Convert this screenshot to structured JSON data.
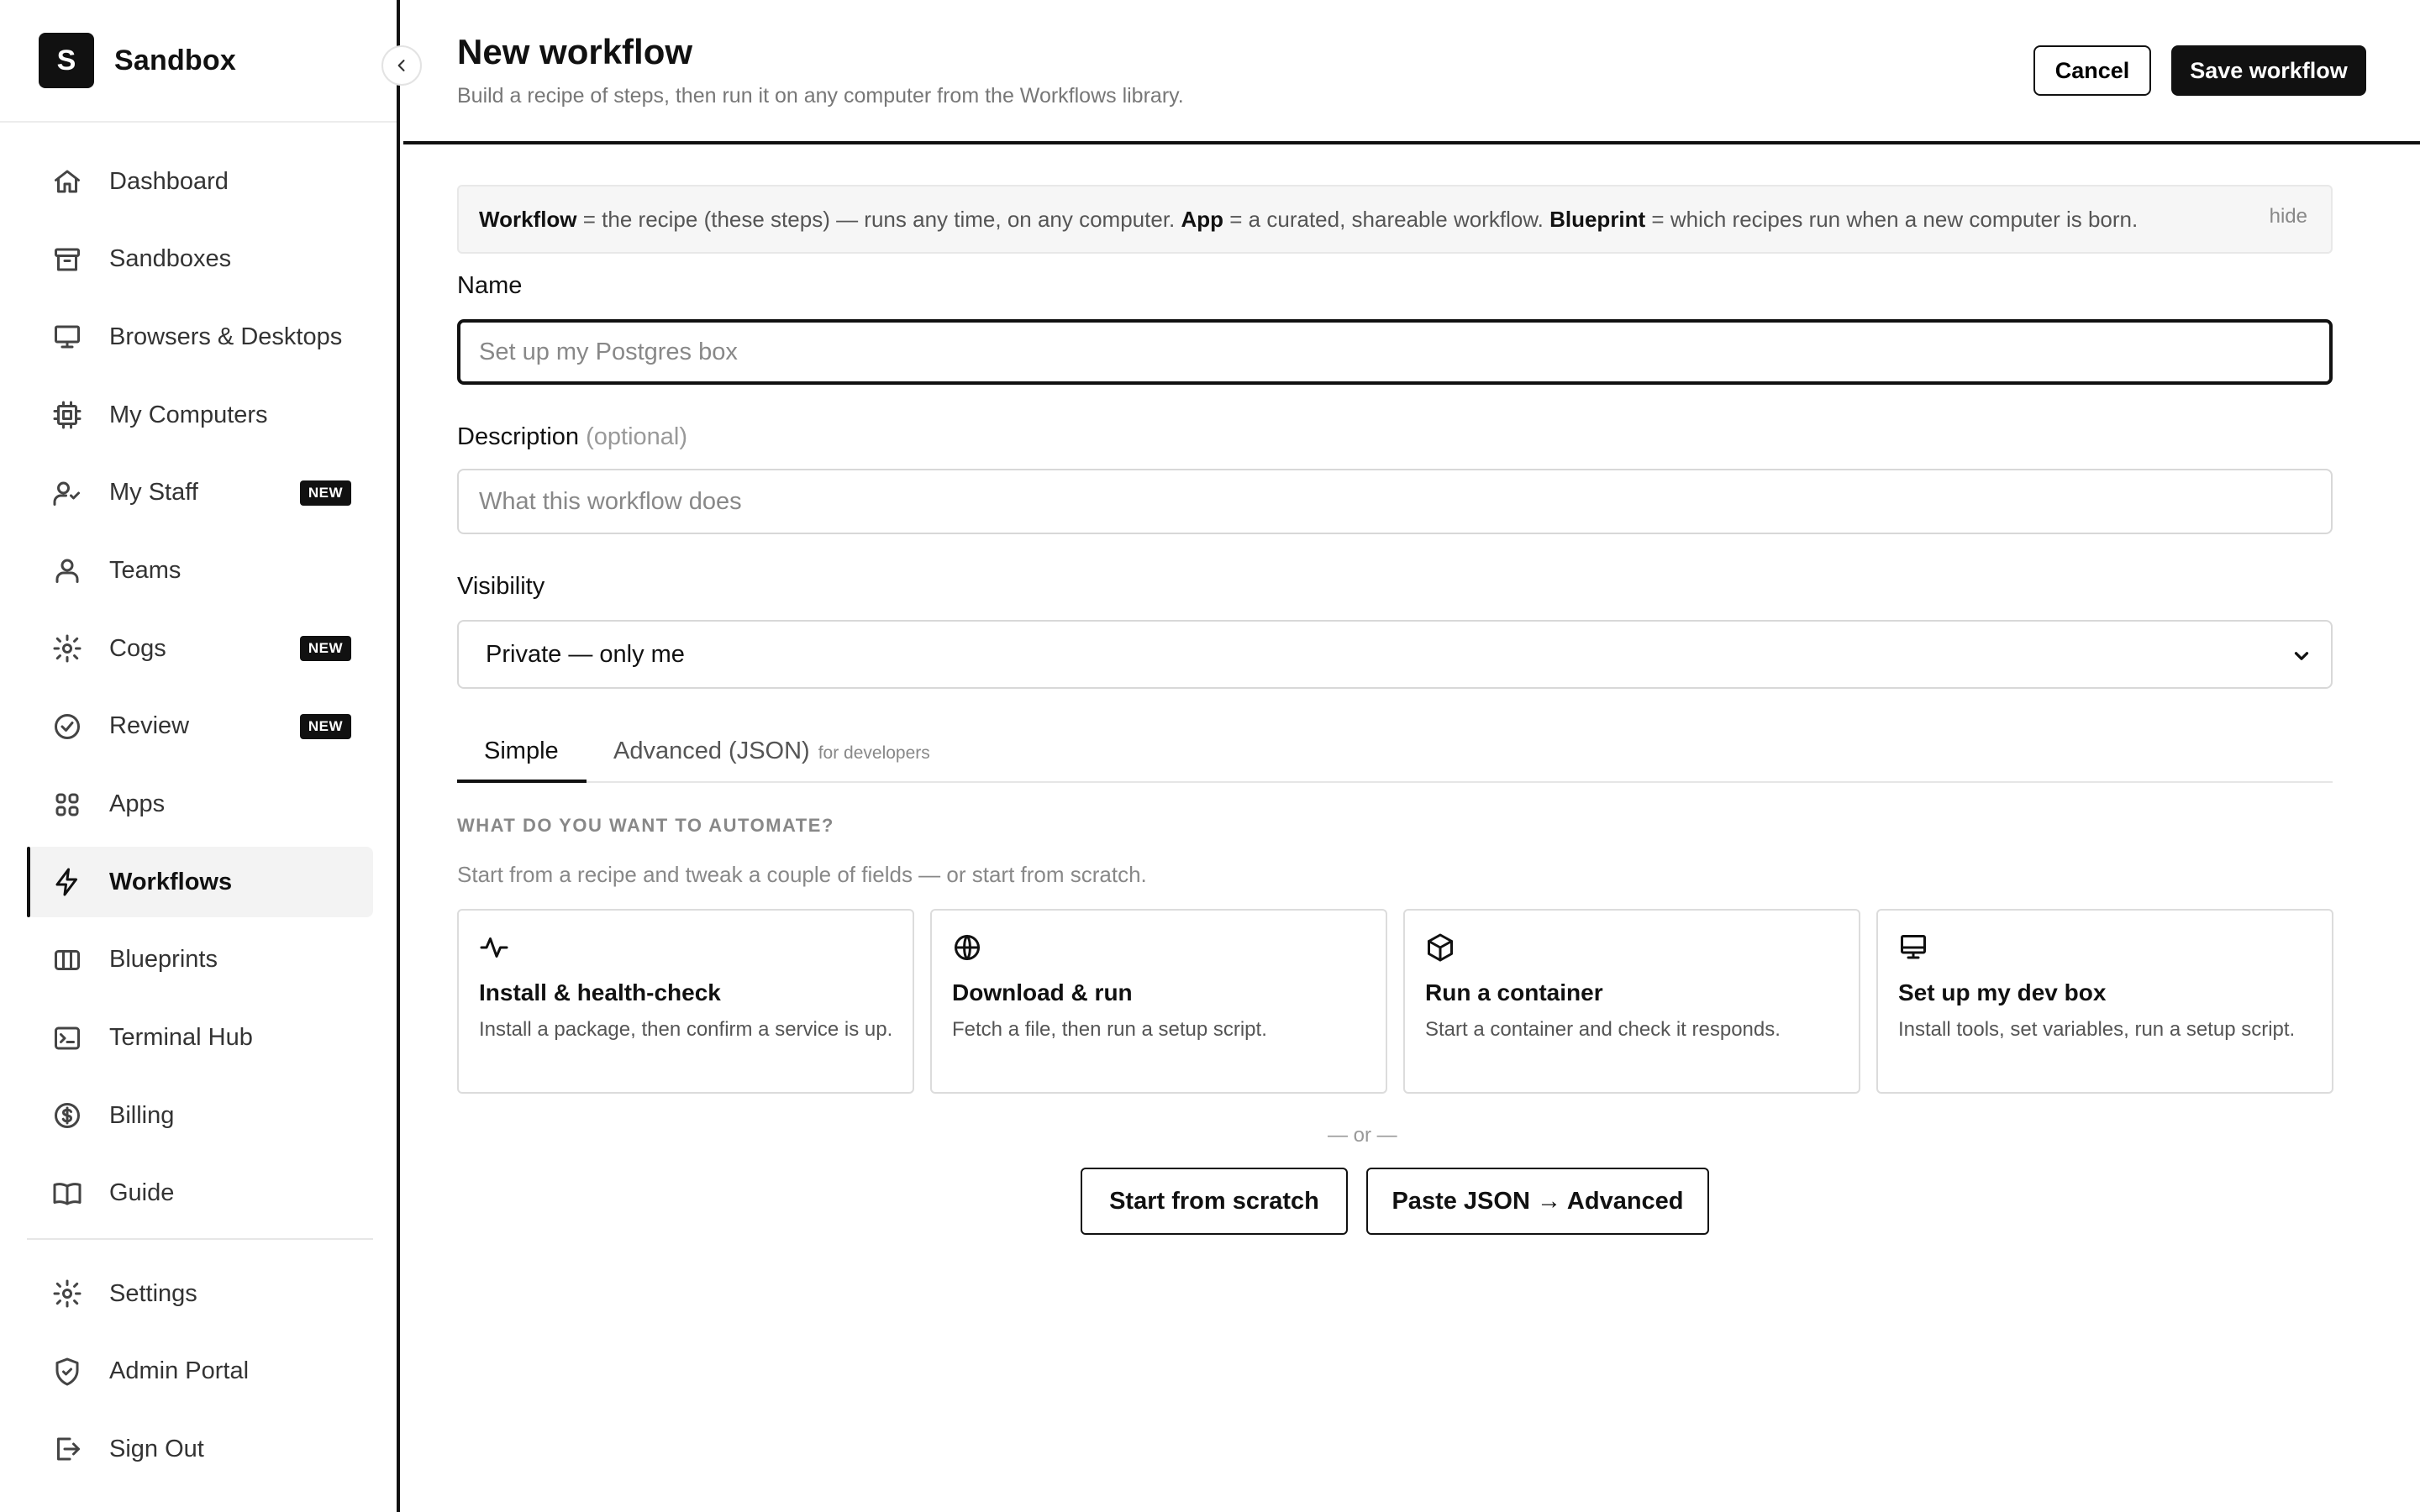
{
  "brand": {
    "logo_letter": "S",
    "name": "Sandbox"
  },
  "sidebar": {
    "items": [
      {
        "label": "Dashboard",
        "icon": "home-icon",
        "badge": ""
      },
      {
        "label": "Sandboxes",
        "icon": "archive-icon",
        "badge": ""
      },
      {
        "label": "Browsers & Desktops",
        "icon": "monitor-icon",
        "badge": ""
      },
      {
        "label": "My Computers",
        "icon": "cpu-icon",
        "badge": ""
      },
      {
        "label": "My Staff",
        "icon": "users-icon",
        "badge": "NEW"
      },
      {
        "label": "Teams",
        "icon": "team-icon",
        "badge": ""
      },
      {
        "label": "Cogs",
        "icon": "gear-icon",
        "badge": "NEW"
      },
      {
        "label": "Review",
        "icon": "check-circle-icon",
        "badge": "NEW"
      },
      {
        "label": "Apps",
        "icon": "grid-icon",
        "badge": ""
      },
      {
        "label": "Workflows",
        "icon": "lightning-icon",
        "badge": "",
        "active": true
      },
      {
        "label": "Blueprints",
        "icon": "columns-icon",
        "badge": ""
      },
      {
        "label": "Terminal Hub",
        "icon": "terminal-icon",
        "badge": ""
      },
      {
        "label": "Billing",
        "icon": "dollar-icon",
        "badge": ""
      },
      {
        "label": "Guide",
        "icon": "book-icon",
        "badge": ""
      }
    ],
    "bottom_items": [
      {
        "label": "Settings",
        "icon": "gear-icon"
      },
      {
        "label": "Admin Portal",
        "icon": "shield-icon"
      },
      {
        "label": "Sign Out",
        "icon": "sign-out-icon"
      }
    ]
  },
  "header": {
    "title": "New workflow",
    "subtitle": "Build a recipe of steps, then run it on any computer from the Workflows library.",
    "cancel_label": "Cancel",
    "save_label": "Save workflow"
  },
  "info": {
    "workflow_term": "Workflow",
    "workflow_def": " = the recipe (these steps) — runs any time, on any computer. ",
    "app_term": "App",
    "app_def": " = a curated, shareable workflow. ",
    "blueprint_term": "Blueprint",
    "blueprint_def": " = which recipes run when a new computer is born.",
    "hide_label": "hide"
  },
  "form": {
    "name_label": "Name",
    "name_placeholder": "Set up my Postgres box",
    "name_value": "",
    "description_label": "Description",
    "description_optional": "(optional)",
    "description_placeholder": "What this workflow does",
    "description_value": "",
    "visibility_label": "Visibility",
    "visibility_value": "Private — only me"
  },
  "tabs": {
    "simple": "Simple",
    "advanced": "Advanced (JSON)",
    "advanced_note": "for developers",
    "active": "Simple"
  },
  "automate": {
    "heading": "WHAT DO YOU WANT TO AUTOMATE?",
    "subheading": "Start from a recipe and tweak a couple of fields — or start from scratch.",
    "recipes": [
      {
        "title": "Install & health-check",
        "desc": "Install a package, then confirm a service is up.",
        "icon": "activity-icon"
      },
      {
        "title": "Download & run",
        "desc": "Fetch a file, then run a setup script.",
        "icon": "globe-icon"
      },
      {
        "title": "Run a container",
        "desc": "Start a container and check it responds.",
        "icon": "box-icon"
      },
      {
        "title": "Set up my dev box",
        "desc": "Install tools, set variables, run a setup script.",
        "icon": "monitor-icon"
      }
    ],
    "or_label": "— or —",
    "scratch_label": "Start from scratch",
    "paste_label": "Paste JSON → Advanced"
  },
  "colors": {
    "accent": "#111111",
    "muted": "#888888",
    "border": "#dcdcdc"
  }
}
